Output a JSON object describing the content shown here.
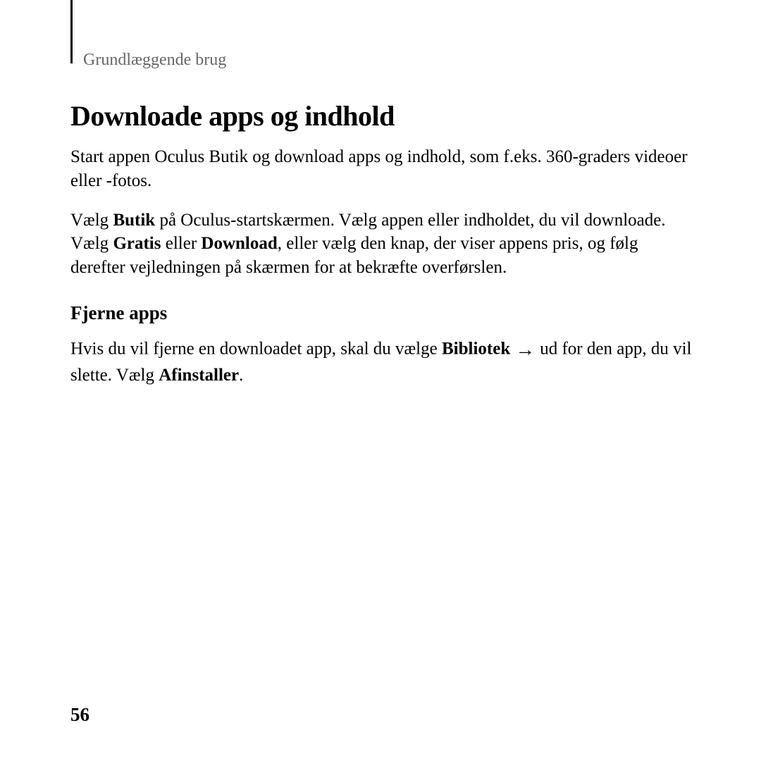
{
  "header": {
    "section_label": "Grundlæggende brug"
  },
  "main": {
    "title": "Downloade apps og indhold",
    "para1": "Start appen Oculus Butik og download apps og indhold, som f.eks. 360-graders videoer eller -fotos.",
    "para2_prefix": "Vælg ",
    "para2_b1": "Butik",
    "para2_mid1": " på Oculus-startskærmen. Vælg appen eller indholdet, du vil downloade. Vælg ",
    "para2_b2": "Gratis",
    "para2_mid2": " eller ",
    "para2_b3": "Download",
    "para2_suffix": ", eller vælg den knap, der viser appens pris, og følg derefter vejledningen på skærmen for at bekræfte overførslen.",
    "subheading": "Fjerne apps",
    "para3_prefix": "Hvis du vil fjerne en downloadet app, skal du vælge ",
    "para3_b1": "Bibliotek",
    "para3_arrow": " → ",
    "para3_mid": "  ud for den app, du vil slette. Vælg ",
    "para3_b2": "Afinstaller",
    "para3_suffix": "."
  },
  "page_number": "56"
}
